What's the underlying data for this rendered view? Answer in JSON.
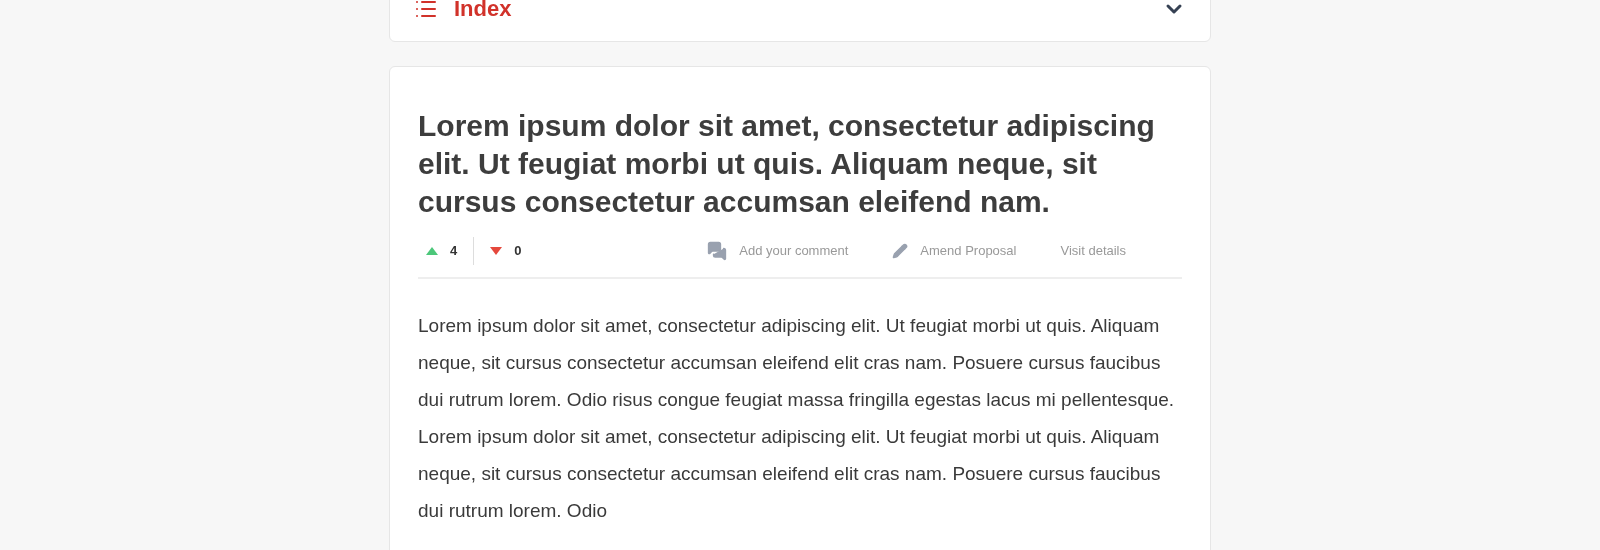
{
  "index_panel": {
    "title": "Index",
    "expanded": false
  },
  "proposal": {
    "title": "Lorem ipsum dolor sit amet, consectetur adipiscing elit. Ut feugiat morbi ut quis. Aliquam neque, sit cursus consectetur accumsan eleifend nam.",
    "votes_up": "4",
    "votes_down": "0",
    "actions": [
      {
        "kind": "comment",
        "label": "Add your comment"
      },
      {
        "kind": "amend",
        "label": "Amend Proposal"
      },
      {
        "kind": "details",
        "label": "Visit details"
      }
    ],
    "body": "Lorem ipsum dolor sit amet, consectetur adipiscing elit. Ut feugiat morbi ut quis. Aliquam neque, sit cursus consectetur accumsan eleifend elit cras nam. Posuere cursus faucibus dui rutrum lorem. Odio risus congue feugiat massa fringilla egestas lacus mi pellentesque. Lorem ipsum dolor sit amet, consectetur adipiscing elit. Ut feugiat morbi ut quis. Aliquam neque, sit cursus consectetur accumsan eleifend elit cras nam. Posuere cursus faucibus dui rutrum lorem. Odio"
  }
}
